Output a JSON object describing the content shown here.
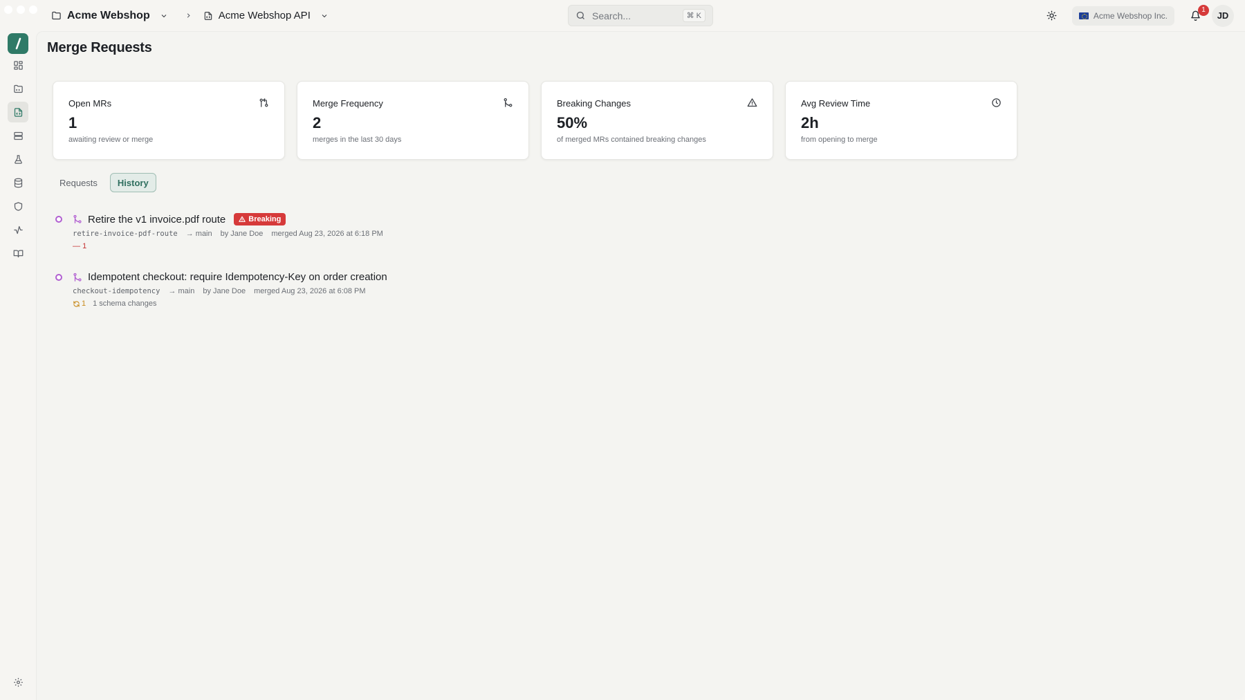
{
  "colors": {
    "accent": "#2f7a67",
    "breaking": "#d63a3a",
    "merged_dot": "#b15fd1",
    "deletion": "#c53030",
    "change": "#c88a1c"
  },
  "breadcrumb": {
    "org": "Acme Webshop",
    "project": "Acme Webshop API"
  },
  "search": {
    "placeholder": "Search...",
    "shortcut": "⌘ K"
  },
  "header": {
    "org_pill": "Acme Webshop Inc.",
    "notification_count": "1",
    "avatar_initials": "JD"
  },
  "sidebar": {
    "items": [
      {
        "icon": "dashboard-icon"
      },
      {
        "icon": "folder-icon"
      },
      {
        "icon": "api-file-icon",
        "active": true
      },
      {
        "icon": "servers-icon"
      },
      {
        "icon": "flask-icon"
      },
      {
        "icon": "database-icon"
      },
      {
        "icon": "shield-icon"
      },
      {
        "icon": "activity-icon"
      },
      {
        "icon": "book-icon"
      }
    ],
    "bottom_icon": "gear-icon"
  },
  "page": {
    "title": "Merge Requests"
  },
  "cards": [
    {
      "title": "Open MRs",
      "value": "1",
      "sub": "awaiting review or merge",
      "icon": "pull-request-icon"
    },
    {
      "title": "Merge Frequency",
      "value": "2",
      "sub": "merges in the last 30 days",
      "icon": "merge-icon"
    },
    {
      "title": "Breaking Changes",
      "value": "50%",
      "sub": "of merged MRs contained breaking changes",
      "icon": "warning-icon"
    },
    {
      "title": "Avg Review Time",
      "value": "2h",
      "sub": "from opening to merge",
      "icon": "clock-icon"
    }
  ],
  "tabs": [
    {
      "label": "Requests",
      "active": false
    },
    {
      "label": "History",
      "active": true
    }
  ],
  "history": [
    {
      "title": "Retire the v1 invoice.pdf route",
      "badge": "Breaking",
      "branch": "retire-invoice-pdf-route",
      "target": "main",
      "author": "by Jane Doe",
      "merged": "merged Aug 23, 2026 at 6:18 PM",
      "deletions": "1"
    },
    {
      "title": "Idempotent checkout: require Idempotency-Key on order creation",
      "branch": "checkout-idempotency",
      "target": "main",
      "author": "by Jane Doe",
      "merged": "merged Aug 23, 2026 at 6:08 PM",
      "changes": "1",
      "changes_label": "1 schema changes"
    }
  ]
}
